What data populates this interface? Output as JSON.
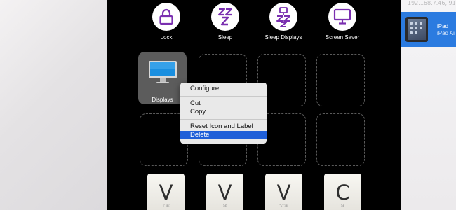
{
  "right_panel": {
    "ip_text": "192.168.7.46, 91",
    "device_name": "iPad",
    "device_model": "iPad Ai"
  },
  "top_buttons": [
    {
      "label": "Lock",
      "icon": "lock-icon"
    },
    {
      "label": "Sleep",
      "icon": "sleep-zzz-icon"
    },
    {
      "label": "Sleep Displays",
      "icon": "sleep-displays-icon"
    },
    {
      "label": "Screen Saver",
      "icon": "screen-saver-icon"
    }
  ],
  "grid": {
    "selected_slot_label": "Displays",
    "selected_slot_icon": "monitor-icon"
  },
  "context_menu": {
    "items": [
      "Configure...",
      "Cut",
      "Copy",
      "Reset Icon and Label",
      "Delete"
    ],
    "highlighted": "Delete"
  },
  "keys": [
    {
      "glyph": "V",
      "modifier": "⇧⌘"
    },
    {
      "glyph": "V",
      "modifier": "⌘"
    },
    {
      "glyph": "V",
      "modifier": "⌥⌘"
    },
    {
      "glyph": "C",
      "modifier": "⌘"
    }
  ],
  "colors": {
    "accent_purple": "#7a2fb0",
    "menu_highlight": "#1f5fd8",
    "device_highlight": "#2b7be0"
  }
}
